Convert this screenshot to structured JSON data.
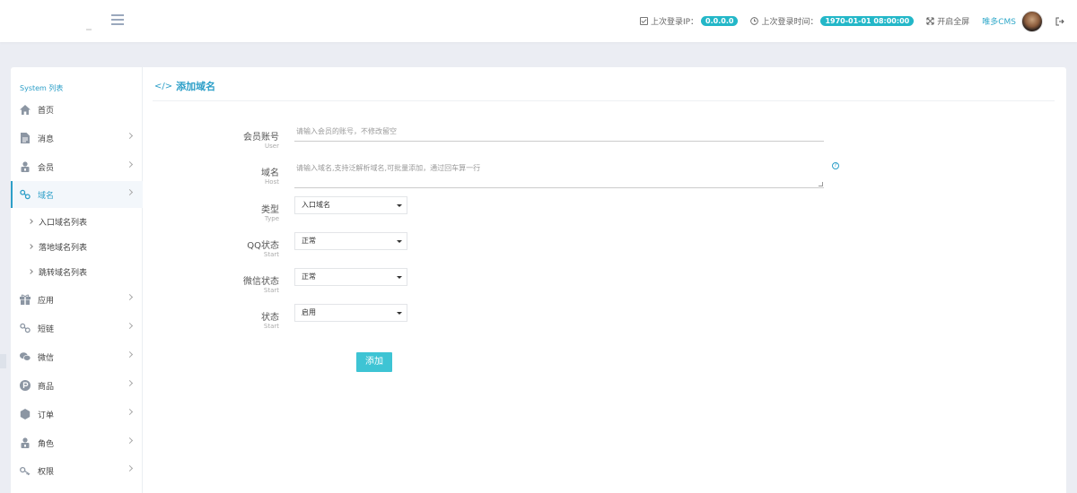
{
  "header": {
    "last_ip_label": "上次登录IP：",
    "last_ip_value": "0.0.0.0",
    "last_time_label": "上次登录时间：",
    "last_time_value": "1970-01-01 08:00:00",
    "fullscreen_label": "开启全屏",
    "user_name": "唯多CMS"
  },
  "sidebar": {
    "title": "System 列表",
    "items": [
      {
        "label": "首页",
        "icon": "home-icon"
      },
      {
        "label": "消息",
        "icon": "document-icon"
      },
      {
        "label": "会员",
        "icon": "user-lock-icon"
      },
      {
        "label": "域名",
        "icon": "link-icon"
      },
      {
        "label": "应用",
        "icon": "gift-icon"
      },
      {
        "label": "短链",
        "icon": "link-icon"
      },
      {
        "label": "微信",
        "icon": "wechat-icon"
      },
      {
        "label": "商品",
        "icon": "product-p-icon"
      },
      {
        "label": "订单",
        "icon": "hexagon-icon"
      },
      {
        "label": "角色",
        "icon": "user-lock-icon"
      },
      {
        "label": "权限",
        "icon": "key-icon"
      }
    ],
    "subitems": [
      "入口域名列表",
      "落地域名列表",
      "跳转域名列表"
    ]
  },
  "page": {
    "title": "添加域名"
  },
  "form": {
    "member": {
      "label": "会员账号",
      "sub": "User",
      "placeholder": "请输入会员的账号，不修改留空"
    },
    "host": {
      "label": "域名",
      "sub": "Host",
      "placeholder": "请输入域名,支持泛解析域名,可批量添加，通过回车算一行"
    },
    "type": {
      "label": "类型",
      "sub": "Type",
      "value": "入口域名"
    },
    "qq": {
      "label": "QQ状态",
      "sub": "Start",
      "value": "正常"
    },
    "wechat": {
      "label": "微信状态",
      "sub": "Start",
      "value": "正常"
    },
    "status": {
      "label": "状态",
      "sub": "Start",
      "value": "启用"
    },
    "submit": "添加"
  },
  "colors": {
    "accent": "#2d9fc8",
    "button": "#3ec4d4",
    "pill": "#23b7c8"
  }
}
